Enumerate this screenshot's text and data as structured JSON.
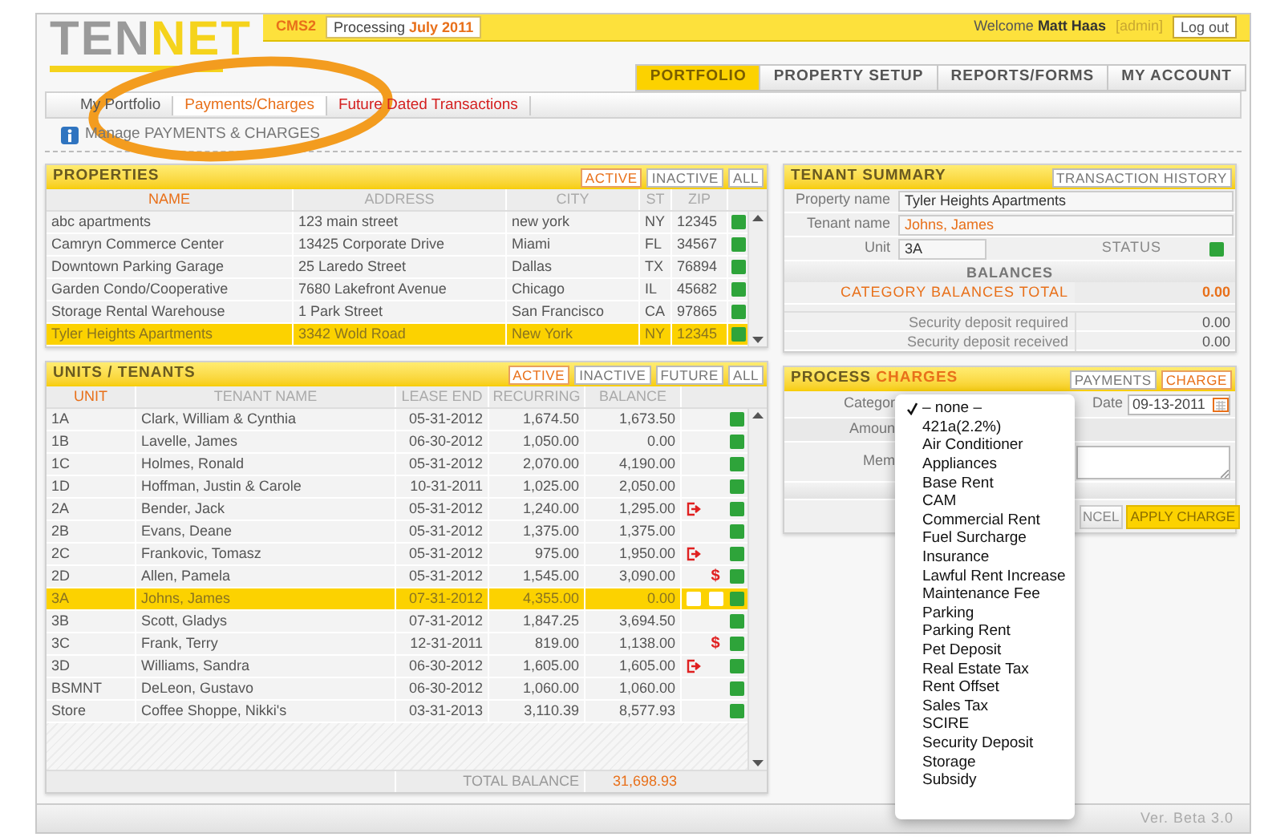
{
  "logo": {
    "text": "TEN",
    "accent": "NET"
  },
  "top_bar": {
    "app": "CMS2",
    "processing_label": "Processing",
    "processing_period": "July 2011",
    "welcome": "Welcome",
    "user": "Matt Haas",
    "role": "[admin]",
    "logout": "Log out"
  },
  "main_tabs": [
    {
      "label": "PORTFOLIO",
      "selected": true
    },
    {
      "label": "PROPERTY SETUP",
      "selected": false
    },
    {
      "label": "REPORTS/FORMS",
      "selected": false
    },
    {
      "label": "MY ACCOUNT",
      "selected": false
    }
  ],
  "sub_tabs": [
    {
      "label": "My Portfolio",
      "selected": false,
      "alert": false
    },
    {
      "label": "Payments/Charges",
      "selected": true,
      "alert": false
    },
    {
      "label": "Future Dated Transactions",
      "selected": false,
      "alert": true
    }
  ],
  "breadcrumb": "Manage PAYMENTS & CHARGES",
  "properties": {
    "title": "PROPERTIES",
    "filters": [
      {
        "label": "ACTIVE",
        "selected": true
      },
      {
        "label": "INACTIVE",
        "selected": false
      },
      {
        "label": "ALL",
        "selected": false
      }
    ],
    "columns": [
      {
        "label": "NAME",
        "sorted": true
      },
      {
        "label": "ADDRESS",
        "sorted": false
      },
      {
        "label": "CITY",
        "sorted": false
      },
      {
        "label": "ST",
        "sorted": false
      },
      {
        "label": "ZIP",
        "sorted": false
      }
    ],
    "rows": [
      {
        "name": "abc apartments",
        "address": "123 main street",
        "city": "new york",
        "st": "NY",
        "zip": "12345",
        "active": true,
        "selected": false
      },
      {
        "name": "Camryn Commerce Center",
        "address": "13425 Corporate Drive",
        "city": "Miami",
        "st": "FL",
        "zip": "34567",
        "active": true,
        "selected": false
      },
      {
        "name": "Downtown Parking Garage",
        "address": "25 Laredo Street",
        "city": "Dallas",
        "st": "TX",
        "zip": "76894",
        "active": true,
        "selected": false
      },
      {
        "name": "Garden Condo/Cooperative",
        "address": "7680 Lakefront Avenue",
        "city": "Chicago",
        "st": "IL",
        "zip": "45682",
        "active": true,
        "selected": false
      },
      {
        "name": "Storage Rental Warehouse",
        "address": "1 Park Street",
        "city": "San Francisco",
        "st": "CA",
        "zip": "97865",
        "active": true,
        "selected": false
      },
      {
        "name": "Tyler Heights Apartments",
        "address": "3342 Wold Road",
        "city": "New York",
        "st": "NY",
        "zip": "12345",
        "active": true,
        "selected": true
      }
    ]
  },
  "units": {
    "title": "UNITS / TENANTS",
    "filters": [
      {
        "label": "ACTIVE",
        "selected": true
      },
      {
        "label": "INACTIVE",
        "selected": false
      },
      {
        "label": "FUTURE",
        "selected": false
      },
      {
        "label": "ALL",
        "selected": false
      }
    ],
    "columns": [
      {
        "label": "UNIT",
        "sorted": true
      },
      {
        "label": "TENANT NAME",
        "sorted": false
      },
      {
        "label": "LEASE END",
        "sorted": false
      },
      {
        "label": "RECURRING",
        "sorted": false
      },
      {
        "label": "BALANCE",
        "sorted": false
      }
    ],
    "rows": [
      {
        "unit": "1A",
        "tenant": "Clark, William & Cynthia",
        "lease_end": "05-31-2012",
        "recurring": "1,674.50",
        "balance": "1,673.50",
        "move_out": false,
        "active": true,
        "selected": false
      },
      {
        "unit": "1B",
        "tenant": "Lavelle, James",
        "lease_end": "06-30-2012",
        "recurring": "1,050.00",
        "balance": "0.00",
        "move_out": false,
        "active": true,
        "selected": false
      },
      {
        "unit": "1C",
        "tenant": "Holmes, Ronald",
        "lease_end": "05-31-2012",
        "recurring": "2,070.00",
        "balance": "4,190.00",
        "move_out": false,
        "active": true,
        "selected": false
      },
      {
        "unit": "1D",
        "tenant": "Hoffman, Justin & Carole",
        "lease_end": "10-31-2011",
        "recurring": "1,025.00",
        "balance": "2,050.00",
        "move_out": false,
        "active": true,
        "selected": false
      },
      {
        "unit": "2A",
        "tenant": "Bender, Jack",
        "lease_end": "05-31-2012",
        "recurring": "1,240.00",
        "balance": "1,295.00",
        "move_out": true,
        "active": true,
        "selected": false
      },
      {
        "unit": "2B",
        "tenant": "Evans, Deane",
        "lease_end": "05-31-2012",
        "recurring": "1,375.00",
        "balance": "1,375.00",
        "move_out": false,
        "active": true,
        "selected": false
      },
      {
        "unit": "2C",
        "tenant": "Frankovic, Tomasz",
        "lease_end": "05-31-2012",
        "recurring": "975.00",
        "balance": "1,950.00",
        "move_out": true,
        "active": true,
        "selected": false
      },
      {
        "unit": "2D",
        "tenant": "Allen, Pamela",
        "lease_end": "05-31-2012",
        "recurring": "1,545.00",
        "balance": "3,090.00",
        "move_out": false,
        "flag": "$",
        "active": true,
        "selected": false
      },
      {
        "unit": "3A",
        "tenant": "Johns, James",
        "lease_end": "07-31-2012",
        "recurring": "4,355.00",
        "balance": "0.00",
        "move_out": false,
        "active": true,
        "selected": true
      },
      {
        "unit": "3B",
        "tenant": "Scott, Gladys",
        "lease_end": "07-31-2012",
        "recurring": "1,847.25",
        "balance": "3,694.50",
        "move_out": false,
        "active": true,
        "selected": false
      },
      {
        "unit": "3C",
        "tenant": "Frank, Terry",
        "lease_end": "12-31-2011",
        "recurring": "819.00",
        "balance": "1,138.00",
        "move_out": false,
        "flag": "$",
        "active": true,
        "selected": false
      },
      {
        "unit": "3D",
        "tenant": "Williams, Sandra",
        "lease_end": "06-30-2012",
        "recurring": "1,605.00",
        "balance": "1,605.00",
        "move_out": true,
        "active": true,
        "selected": false
      },
      {
        "unit": "BSMNT",
        "tenant": "DeLeon, Gustavo",
        "lease_end": "06-30-2012",
        "recurring": "1,060.00",
        "balance": "1,060.00",
        "move_out": false,
        "active": true,
        "selected": false
      },
      {
        "unit": "Store",
        "tenant": "Coffee Shoppe, Nikki's",
        "lease_end": "03-31-2013",
        "recurring": "3,110.39",
        "balance": "8,577.93",
        "move_out": false,
        "active": true,
        "selected": false
      }
    ],
    "total_label": "TOTAL BALANCE",
    "total": "31,698.93"
  },
  "tenant_summary": {
    "title": "TENANT SUMMARY",
    "history_button": "TRANSACTION HISTORY",
    "property_label": "Property name",
    "property": "Tyler Heights Apartments",
    "tenant_label": "Tenant name",
    "tenant": "Johns, James",
    "unit_label": "Unit",
    "unit": "3A",
    "status_label": "STATUS",
    "active": true,
    "balances_heading": "BALANCES",
    "category_total_label": "CATEGORY BALANCES TOTAL",
    "category_total": "0.00",
    "deposits": [
      {
        "label": "Security deposit required",
        "value": "0.00"
      },
      {
        "label": "Security deposit received",
        "value": "0.00"
      }
    ]
  },
  "process_charges": {
    "title": "PROCESS",
    "title_accent": "CHARGES",
    "modes": [
      {
        "label": "PAYMENTS",
        "selected": false
      },
      {
        "label": "CHARGE",
        "selected": true
      }
    ],
    "category_label": "Categor",
    "date_label": "Date",
    "date": "09-13-2011",
    "amount_label": "Amoun",
    "memo_label": "Mem",
    "cancel": "NCEL",
    "apply": "APPLY CHARGE"
  },
  "category_menu": {
    "items": [
      {
        "label": "– none –",
        "selected": true
      },
      {
        "label": "421a(2.2%)",
        "selected": false
      },
      {
        "label": "Air Conditioner",
        "selected": false
      },
      {
        "label": "Appliances",
        "selected": false
      },
      {
        "label": "Base Rent",
        "selected": false
      },
      {
        "label": "CAM",
        "selected": false
      },
      {
        "label": "Commercial Rent",
        "selected": false
      },
      {
        "label": "Fuel Surcharge",
        "selected": false
      },
      {
        "label": "Insurance",
        "selected": false
      },
      {
        "label": "Lawful Rent Increase",
        "selected": false
      },
      {
        "label": "Maintenance Fee",
        "selected": false
      },
      {
        "label": "Parking",
        "selected": false
      },
      {
        "label": "Parking Rent",
        "selected": false
      },
      {
        "label": "Pet Deposit",
        "selected": false
      },
      {
        "label": "Real Estate Tax",
        "selected": false
      },
      {
        "label": "Rent Offset",
        "selected": false
      },
      {
        "label": "Sales Tax",
        "selected": false
      },
      {
        "label": "SCIRE",
        "selected": false
      },
      {
        "label": "Security Deposit",
        "selected": false
      },
      {
        "label": "Storage",
        "selected": false
      },
      {
        "label": "Subsidy",
        "selected": false
      }
    ]
  },
  "version": "Ver. Beta 3.0"
}
